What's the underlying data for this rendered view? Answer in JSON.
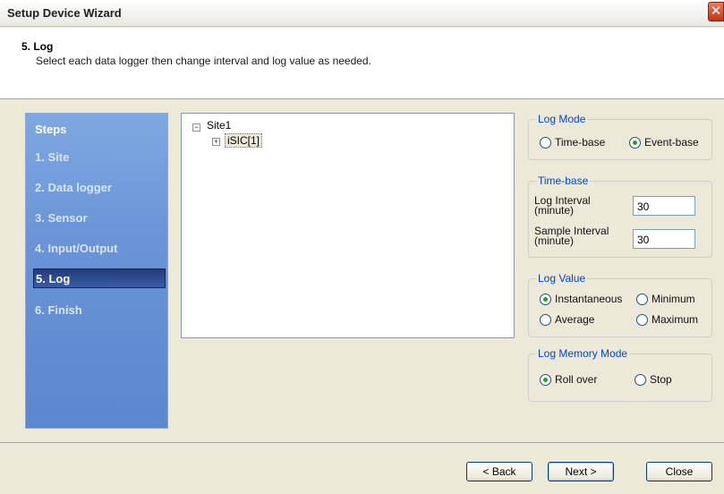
{
  "window": {
    "title": "Setup Device Wizard",
    "close_glyph": "✕"
  },
  "header": {
    "step_title": "5. Log",
    "description": "Select each data logger then change interval and log value as needed."
  },
  "steps": {
    "heading": "Steps",
    "items": [
      "1. Site",
      "2. Data logger",
      "3. Sensor",
      "4. Input/Output",
      "5. Log",
      "6. Finish"
    ],
    "active_index": 4
  },
  "tree": {
    "root": {
      "label": "Site1",
      "expander": "−"
    },
    "child": {
      "label": "iSIC[1]",
      "expander": "+"
    }
  },
  "log_mode": {
    "legend": "Log Mode",
    "options": [
      "Time-base",
      "Event-base"
    ],
    "selected": "Event-base"
  },
  "time_base": {
    "legend": "Time-base",
    "log_interval_label_1": "Log Interval",
    "log_interval_label_2": "(minute)",
    "log_interval_value": "30",
    "sample_interval_label_1": "Sample Interval",
    "sample_interval_label_2": "(minute)",
    "sample_interval_value": "30"
  },
  "log_value": {
    "legend": "Log Value",
    "options": [
      "Instantaneous",
      "Minimum",
      "Average",
      "Maximum"
    ],
    "selected": "Instantaneous"
  },
  "log_memory_mode": {
    "legend": "Log Memory Mode",
    "options": [
      "Roll over",
      "Stop"
    ],
    "selected": "Roll over"
  },
  "buttons": {
    "back": "< Back",
    "next": "Next >",
    "close": "Close"
  }
}
